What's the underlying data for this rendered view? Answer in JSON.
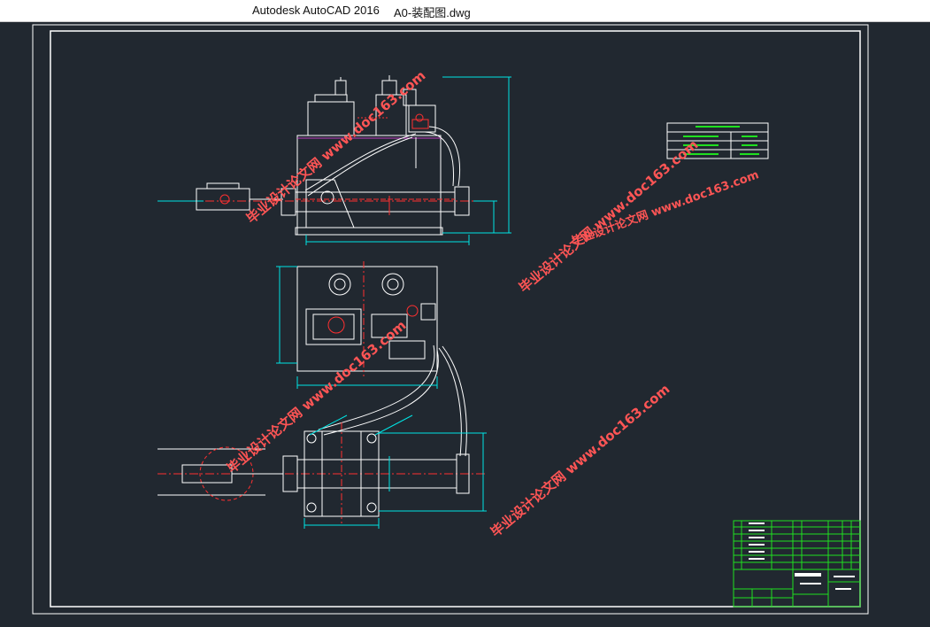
{
  "window": {
    "app_title": "Autodesk AutoCAD 2016",
    "file_name": "A0-装配图.dwg"
  },
  "drawing": {
    "watermarks": [
      {
        "text": "毕业设计论文网 www.doc163.com"
      },
      {
        "text": "毕业设计论文网 www.doc163.com"
      },
      {
        "text": "毕业设计论文网 www.doc163.com"
      },
      {
        "text": "毕业设计论文网 www.doc163.com"
      },
      {
        "text": "毕业设计论文网 www.doc163.com"
      }
    ],
    "colors": {
      "background": "#212830",
      "outline": "#ffffff",
      "dimension": "#00e5e5",
      "center": "#ff3030",
      "hidden": "#c040c0",
      "table": "#20e020",
      "watermark": "#ff5555"
    }
  }
}
